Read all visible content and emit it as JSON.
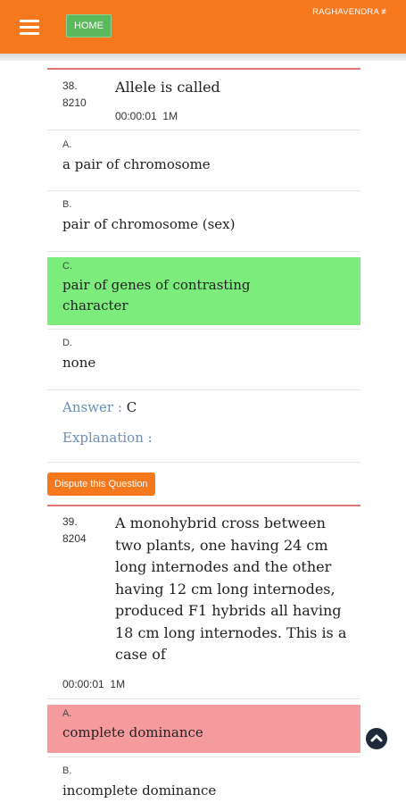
{
  "header": {
    "home_label": "HOME",
    "user": "RAGHAVENDRA ≢"
  },
  "questions": [
    {
      "number": "38.",
      "id": "8210",
      "text": "Allele is called",
      "timer": "00:00:01",
      "marks": "1M",
      "options": [
        {
          "letter": "A.",
          "text": "a pair of chromosome"
        },
        {
          "letter": "B.",
          "text": "pair of chromosome (sex)"
        },
        {
          "letter": "C.",
          "text": "pair of genes of contrasting character"
        },
        {
          "letter": "D.",
          "text": "none"
        }
      ],
      "answer_label": "Answer :",
      "answer_value": "C",
      "explanation_label": "Explanation :"
    },
    {
      "number": "39.",
      "id": "8204",
      "text": "A monohybrid cross between two plants, one having 24 cm long internodes and the other having 12 cm long internodes, produced F1 hybrids all having 18 cm long internodes. This is a case of",
      "timer": "00:00:01",
      "marks": "1M",
      "options": [
        {
          "letter": "A.",
          "text": "complete dominance"
        },
        {
          "letter": "B.",
          "text": "incomplete dominance"
        }
      ]
    }
  ],
  "dispute_label": "Dispute this Question",
  "colors": {
    "header": "#f6781d",
    "correct": "#7ced7c",
    "wrong": "#f59b9e",
    "home": "#5cb85c"
  },
  "icons": {
    "menu": "hamburger-menu-icon",
    "scroll_top": "chevron-up-icon"
  }
}
